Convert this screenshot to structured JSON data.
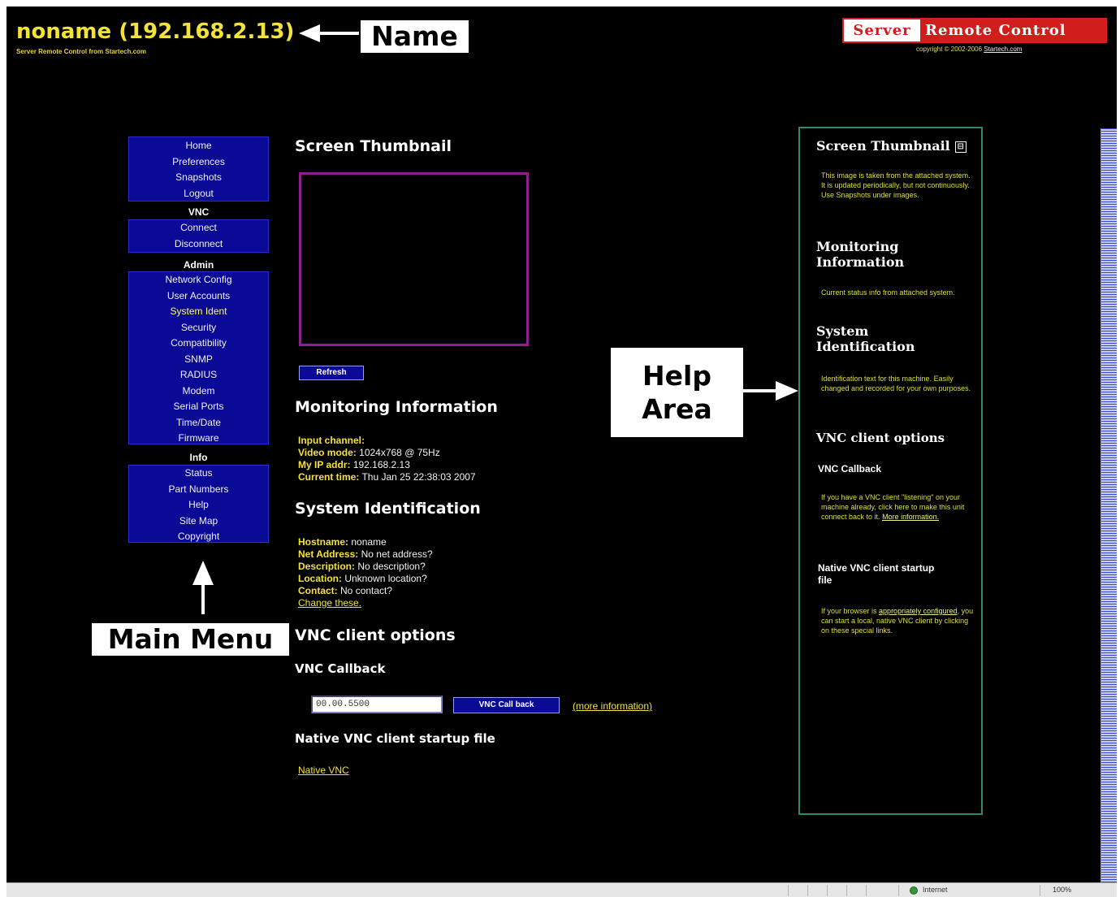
{
  "header": {
    "host_title": "noname (192.168.2.13)",
    "tagline": "Server Remote Control from Startech.com",
    "brand_left": "Server",
    "brand_right": "Remote Control",
    "copyright_text": "copyright © 2002-2006",
    "copyright_link": "Startech.com"
  },
  "callouts": {
    "name": "Name",
    "help_line1": "Help",
    "help_line2": "Area",
    "menu": "Main Menu"
  },
  "menu": {
    "group1": [
      "Home",
      "Preferences",
      "Snapshots",
      "Logout"
    ],
    "vnc_heading": "VNC",
    "vnc": [
      "Connect",
      "Disconnect"
    ],
    "admin_heading": "Admin",
    "admin": [
      "Network Config",
      "User Accounts",
      "System Ident",
      "Security",
      "Compatibility",
      "SNMP",
      "RADIUS",
      "Modem",
      "Serial Ports",
      "Time/Date",
      "Firmware"
    ],
    "info_heading": "Info",
    "info": [
      "Status",
      "Part Numbers",
      "Help",
      "Site Map",
      "Copyright"
    ]
  },
  "main": {
    "thumb_title": "Screen Thumbnail",
    "refresh_label": "Refresh",
    "monitor_title": "Monitoring Information",
    "monitor": {
      "input_channel_key": "Input channel:",
      "input_channel_val": "",
      "video_mode_key": "Video mode:",
      "video_mode_val": "1024x768 @ 75Hz",
      "ip_key": "My IP addr:",
      "ip_val": "192.168.2.13",
      "time_key": "Current time:",
      "time_val": "Thu Jan 25 22:38:03 2007"
    },
    "sysid_title": "System Identification",
    "sysid": {
      "hostname_key": "Hostname:",
      "hostname_val": "noname",
      "netaddr_key": "Net Address:",
      "netaddr_val": "No net address?",
      "desc_key": "Description:",
      "desc_val": "No description?",
      "loc_key": "Location:",
      "loc_val": "Unknown location?",
      "contact_key": "Contact:",
      "contact_val": "No contact?",
      "change_link": "Change these."
    },
    "vnc_title": "VNC client options",
    "callback_title": "VNC Callback",
    "callback_input": "00.00.5500",
    "callback_button": "VNC Call back",
    "more_info": "(more information)",
    "native_title": "Native VNC client startup file",
    "native_link": "Native VNC"
  },
  "help": {
    "thumb_title": "Screen Thumbnail",
    "close_icon": "⊟",
    "thumb_text": "This image is taken from the attached system. It is updated periodically, but not continuously. Use Snapshots under images.",
    "monitor_title": "Monitoring Information",
    "monitor_text": "Current status info from attached system.",
    "sysid_title": "System Identification",
    "sysid_text": "Identification text for this machine. Easily changed and recorded for your own purposes.",
    "vnc_title": "VNC client options",
    "callback_title": "VNC Callback",
    "callback_text": "If you have a VNC client \"listening\" on your machine already, click here to make this unit connect back to it.",
    "callback_link": "More information.",
    "native_title": "Native VNC client startup file",
    "native_text_a": "If your browser is",
    "native_link": "appropriately configured",
    "native_text_b": ", you can start a local, native VNC client by clicking on these special links."
  },
  "statusbar": {
    "zone": "Internet",
    "zoom": "100%"
  },
  "colors": {
    "accent_yellow": "#f3e23a",
    "menu_blue": "#0a0a96",
    "brand_red": "#d21d1d",
    "thumb_border": "#8b1f8b",
    "help_border": "#2f8a6a"
  }
}
